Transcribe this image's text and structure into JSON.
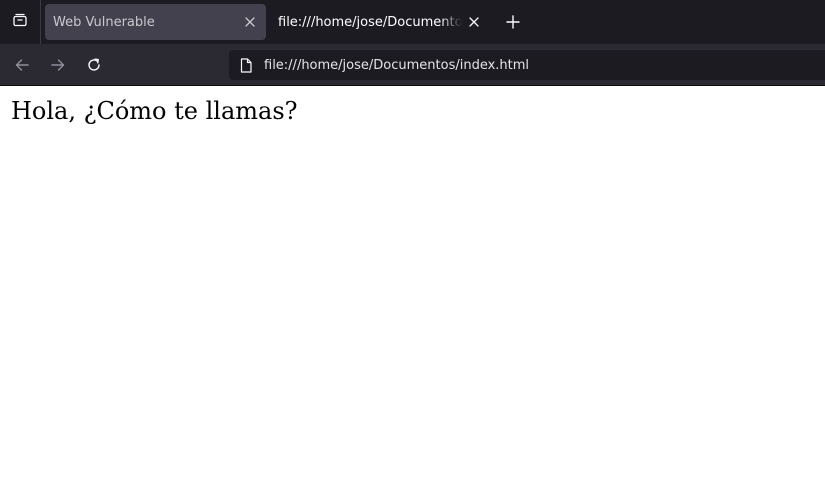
{
  "tabs": [
    {
      "title": "Web Vulnerable",
      "active": false
    },
    {
      "title": "file:///home/jose/Documentos/index.html",
      "active": true
    }
  ],
  "urlbar": {
    "url": "file:///home/jose/Documentos/index.html"
  },
  "icons": {
    "tab_list": "tab-list-icon",
    "close": "close-icon",
    "new_tab": "plus-icon",
    "back": "back-arrow-icon",
    "forward": "forward-arrow-icon",
    "reload": "reload-icon",
    "page": "page-icon"
  },
  "page": {
    "heading": "Hola, ¿Cómo te llamas?"
  },
  "colors": {
    "tabstrip_bg": "#1c1b22",
    "inactive_tab_bg": "#42414d",
    "navbar_bg": "#2b2a33",
    "urlbar_bg": "#1c1b22"
  }
}
